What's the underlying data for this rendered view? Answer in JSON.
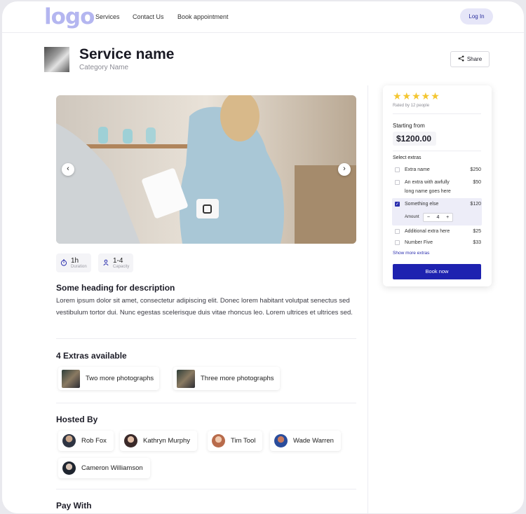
{
  "nav": {
    "logo": "logo",
    "links": [
      "Services",
      "Contact Us",
      "Book appointment"
    ],
    "login": "Log In"
  },
  "header": {
    "title": "Service name",
    "category": "Category Name",
    "share": "Share"
  },
  "stats": {
    "duration_value": "1h",
    "duration_label": "Duration",
    "capacity_value": "1-4",
    "capacity_label": "Capacity"
  },
  "description": {
    "heading": "Some heading for description",
    "text": "Lorem ipsum dolor sit amet, consectetur adipiscing elit. Donec lorem habitant volutpat senectus sed vestibulum tortor dui. Nunc egestas scelerisque duis vitae rhoncus leo. Lorem ultrices et ultrices sed."
  },
  "extras_section": {
    "heading": "4 Extras available",
    "items": [
      "Two more photographs",
      "Three more photographs"
    ]
  },
  "hosted": {
    "heading": "Hosted By",
    "hosts": [
      "Rob Fox",
      "Kathryn Murphy",
      "Tim Tool",
      "Wade Warren",
      "Cameron Williamson"
    ]
  },
  "pay": {
    "heading": "Pay With"
  },
  "booking": {
    "stars": "★★★★★",
    "rating": 5,
    "rated_by": "Rated by 12 people",
    "starting_from": "Starting from",
    "price": "$1200.00",
    "select_extras": "Select extras",
    "extras": [
      {
        "name": "Extra name",
        "price": "$250",
        "checked": false
      },
      {
        "name": "An extra with awfully long name goes here",
        "price": "$50",
        "checked": false
      },
      {
        "name": "Something else",
        "price": "$120",
        "checked": true
      },
      {
        "name": "Additional extra here",
        "price": "$25",
        "checked": false
      },
      {
        "name": "Number Five",
        "price": "$33",
        "checked": false
      }
    ],
    "amount_label": "Amount",
    "amount_value": "4",
    "minus": "−",
    "plus": "+",
    "show_more": "Show more extras",
    "book_now": "Book now"
  },
  "colors": {
    "accent": "#1e22b0",
    "star": "#f4c630",
    "login_bg": "#e6e6f8"
  }
}
